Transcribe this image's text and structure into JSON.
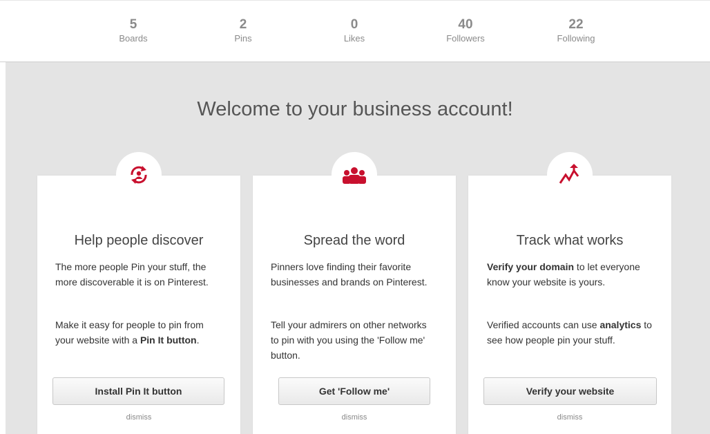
{
  "stats": [
    {
      "count": "5",
      "label": "Boards"
    },
    {
      "count": "2",
      "label": "Pins"
    },
    {
      "count": "0",
      "label": "Likes"
    },
    {
      "count": "40",
      "label": "Followers"
    },
    {
      "count": "22",
      "label": "Following"
    }
  ],
  "welcome_title": "Welcome to your business account!",
  "colors": {
    "accent": "#c8102e",
    "panel_bg": "#e4e4e4"
  },
  "cards": [
    {
      "icon": "refresh-people-icon",
      "title": "Help people discover",
      "p1": "The more people Pin your stuff, the more discoverable it is on Pinterest.",
      "p2_prefix": "Make it easy for people to pin from your website with a ",
      "p2_bold": "Pin It button",
      "p2_suffix": ".",
      "button": "Install Pin It button",
      "dismiss": "dismiss"
    },
    {
      "icon": "people-group-icon",
      "title": "Spread the word",
      "p1": "Pinners love finding their favorite businesses and brands on Pinterest.",
      "p2": "Tell your admirers on other networks to pin with you using the 'Follow me' button.",
      "button": "Get 'Follow me'",
      "dismiss": "dismiss"
    },
    {
      "icon": "trending-arrow-icon",
      "title": "Track what works",
      "p1_bold": "Verify your domain",
      "p1_suffix": " to let everyone know your website is yours.",
      "p2_prefix": "Verified accounts can use ",
      "p2_bold": "analytics",
      "p2_suffix": " to see how people pin your stuff.",
      "button": "Verify your website",
      "dismiss": "dismiss"
    }
  ]
}
